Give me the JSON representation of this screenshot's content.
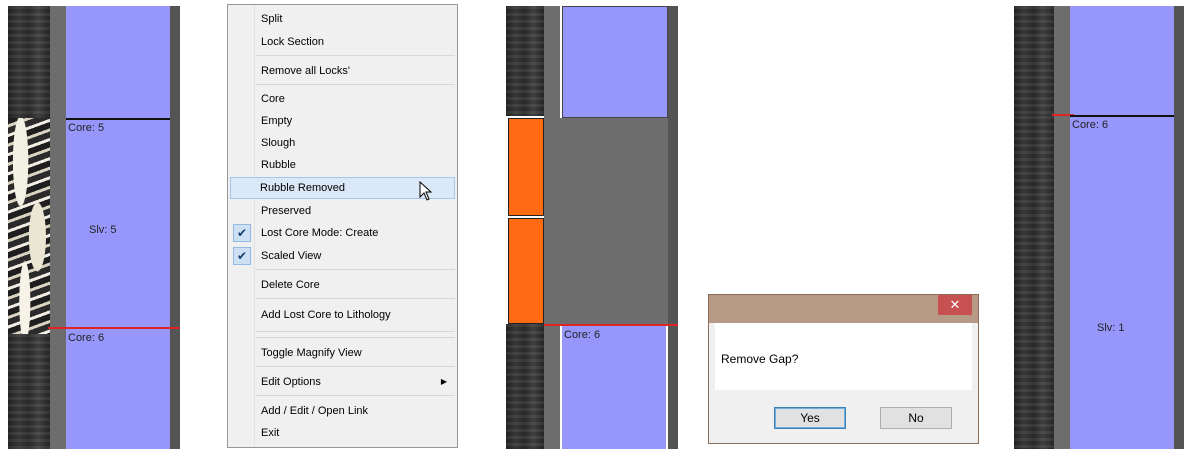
{
  "panel1": {
    "labels": {
      "core_upper": "Core: 5",
      "sleeve": "Slv: 5",
      "core_lower": "Core: 6"
    }
  },
  "context_menu": {
    "items": [
      {
        "label": "Split"
      },
      {
        "label": "Lock Section"
      },
      {
        "label": "Remove all Locks'"
      },
      {
        "label": "Core"
      },
      {
        "label": "Empty"
      },
      {
        "label": "Slough"
      },
      {
        "label": "Rubble"
      },
      {
        "label": "Rubble Removed",
        "highlighted": true
      },
      {
        "label": "Preserved"
      },
      {
        "label": "Lost Core Mode: Create",
        "checked": true
      },
      {
        "label": "Scaled View",
        "checked": true
      },
      {
        "label": "Delete Core"
      },
      {
        "label": "Add Lost Core to Lithology"
      },
      {
        "label": "Toggle Magnify View"
      },
      {
        "label": "Edit Options",
        "submenu": true
      },
      {
        "label": "Add / Edit / Open Link"
      },
      {
        "label": "Exit"
      }
    ]
  },
  "panel3": {
    "labels": {
      "core_lower": "Core: 6"
    },
    "colors": {
      "gap": "#6d6d6d",
      "lost_core": "#ff6a12"
    }
  },
  "dialog": {
    "close_glyph": "✕",
    "message": "Remove Gap?",
    "yes_label": "Yes",
    "no_label": "No"
  },
  "panel5": {
    "labels": {
      "core": "Core: 6",
      "sleeve": "Slv: 1"
    }
  },
  "colors": {
    "sleeve": "#9797fb",
    "boundary_line": "#111111",
    "marker_line": "#e02424"
  }
}
